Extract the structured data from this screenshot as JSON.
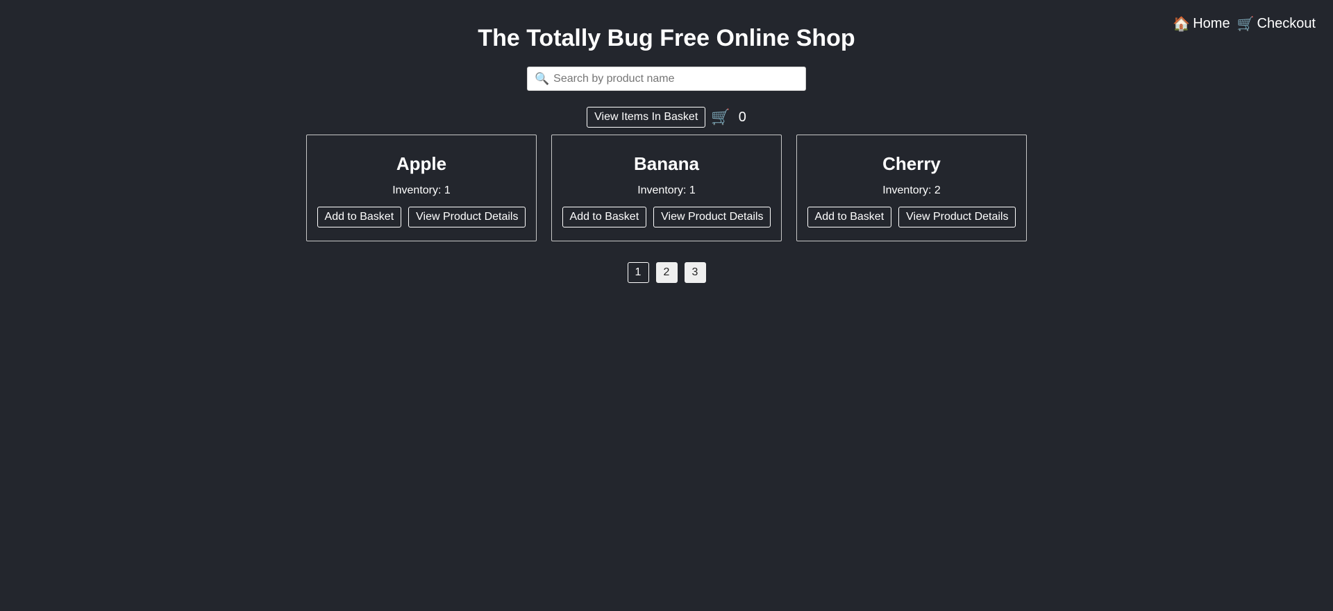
{
  "nav": {
    "home_icon": "🏠",
    "home_label": "Home",
    "checkout_icon": "🛒",
    "checkout_label": "Checkout"
  },
  "header": {
    "title": "The Totally Bug Free Online Shop"
  },
  "search": {
    "icon": "🔍",
    "placeholder": "Search by product name",
    "value": ""
  },
  "basket": {
    "view_label": "View Items In Basket",
    "cart_icon": "🛒",
    "count": "0"
  },
  "products": [
    {
      "name": "Apple",
      "inventory": "Inventory: 1",
      "add_label": "Add to Basket",
      "details_label": "View Product Details"
    },
    {
      "name": "Banana",
      "inventory": "Inventory: 1",
      "add_label": "Add to Basket",
      "details_label": "View Product Details"
    },
    {
      "name": "Cherry",
      "inventory": "Inventory: 2",
      "add_label": "Add to Basket",
      "details_label": "View Product Details"
    }
  ],
  "pagination": {
    "pages": [
      "1",
      "2",
      "3"
    ],
    "current": "1"
  },
  "colors": {
    "background": "#23262d",
    "text": "#ffffff",
    "inactive_page": "#efefef"
  }
}
